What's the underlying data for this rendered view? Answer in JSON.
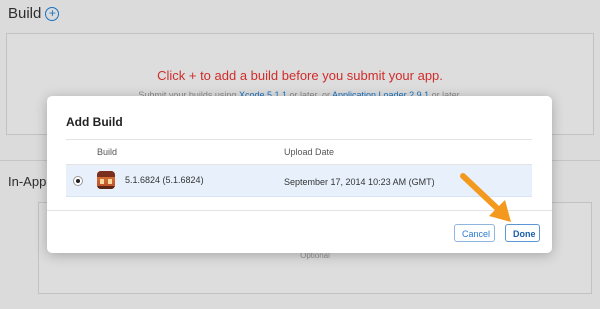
{
  "background": {
    "section_title": "Build",
    "add_icon_glyph": "+",
    "cta_text": "Click + to add a build before you submit your app.",
    "sub_text_before": "Submit your builds using ",
    "sub_link_1": "Xcode 5.1.1",
    "sub_text_mid": " or later, or ",
    "sub_link_2": "Application Loader 2.9.1",
    "sub_text_after": " or later.",
    "second_section_title": "In-App",
    "optional_text": "Optional"
  },
  "modal": {
    "title": "Add Build",
    "columns": {
      "build": "Build",
      "upload_date": "Upload Date"
    },
    "rows": [
      {
        "selected": true,
        "version": "5.1.6824 (5.1.6824)",
        "upload_date": "September 17, 2014 10:23 AM (GMT)",
        "icon": "app-icon"
      }
    ],
    "buttons": {
      "cancel": "Cancel",
      "done": "Done"
    }
  },
  "colors": {
    "accent": "#1a7fd6",
    "cta_red": "#e8312f",
    "selected_row": "#e8f1fb",
    "arrow_orange": "#f39a1e"
  }
}
